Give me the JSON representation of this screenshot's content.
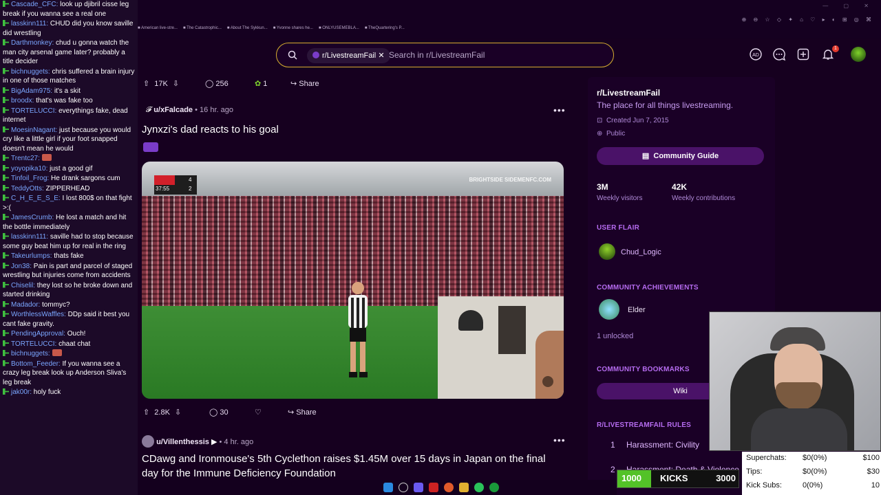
{
  "chat": [
    {
      "user": "Cascade_CFC",
      "text": "look up djibril cisse leg break if you wanna see a real one"
    },
    {
      "user": "lasskinn111",
      "text": "CHUD did you know saville did wrestling"
    },
    {
      "user": "Darthmonkey",
      "text": "chud u gonna watch the man city arsenal game later? probably a title decider"
    },
    {
      "user": "bichnuggets",
      "text": "chris suffered a brain injury in one of those matches"
    },
    {
      "user": "BigAdam975",
      "text": "it's a skit"
    },
    {
      "user": "broodx",
      "text": "that's was fake too"
    },
    {
      "user": "TORTELUCCI",
      "text": "everythings fake, dead internet"
    },
    {
      "user": "MoesinNagant",
      "text": "just because you would cry like a little girl if your foot snapped doesn't mean he would"
    },
    {
      "user": "Trentc27",
      "text": ""
    },
    {
      "user": "yoyopika10",
      "text": "just a good gif"
    },
    {
      "user": "Tinfoil_Frog",
      "text": "He drank sargons cum"
    },
    {
      "user": "TeddyOtts",
      "text": "ZIPPERHEAD"
    },
    {
      "user": "C_H_E_E_S_E",
      "text": "I lost 800$ on that fight >:("
    },
    {
      "user": "JamesCrumb",
      "text": "He lost a match and hit the bottle immediately"
    },
    {
      "user": "lasskinn111",
      "text": "saville had to stop because some guy beat him up for real in the ring"
    },
    {
      "user": "Takeurlumps",
      "text": "thats fake"
    },
    {
      "user": "Jon38",
      "text": "Pain is part and parcel of staged wrestling but injuries come from accidents"
    },
    {
      "user": "Chiselil",
      "text": "they lost so he broke down and started drinking"
    },
    {
      "user": "Madador",
      "text": "tommyc?"
    },
    {
      "user": "WorthlessWaffles",
      "text": "DDp said it best you cant fake gravity."
    },
    {
      "user": "PendingApproval",
      "text": "Ouch!"
    },
    {
      "user": "TORTELUCCI",
      "text": "chaat chat"
    },
    {
      "user": "bichnuggets",
      "text": ""
    },
    {
      "user": "Bottom_Feeder",
      "text": "If you wanna see a crazy leg break look up Anderson Sliva's leg break"
    },
    {
      "user": "jak00r",
      "text": "holy fuck"
    }
  ],
  "browser": {
    "bookmarks": [
      "American live-stre...",
      "The Catastrophic...",
      "About The Sykkun...",
      "Yvonne shares he...",
      "ONLYUSEMEBLA...",
      "TheQuartering's P..."
    ]
  },
  "header": {
    "subreddit_chip": "r/LivestreamFail",
    "search_placeholder": "Search in r/LivestreamFail",
    "notification_count": "1"
  },
  "posts": [
    {
      "upvotes": "17K",
      "comments": "256",
      "awards": "1",
      "share_label": "Share"
    },
    {
      "author": "u/xFalcade",
      "age": "16 hr. ago",
      "title": "Jynxzi's dad reacts to his goal",
      "video": {
        "watermark": "BRIGHTSIDE  SIDEMENFC.COM",
        "score_time": "37:55",
        "score_home": "4",
        "score_away": "2"
      },
      "upvotes": "2.8K",
      "comments": "30",
      "share_label": "Share"
    },
    {
      "author": "u/Villenthessis",
      "age": "4 hr. ago",
      "title": "CDawg and Ironmouse's 5th Cyclethon raises $1.45M over 15 days in Japan on the final day for the Immune Deficiency Foundation"
    }
  ],
  "sidebar": {
    "name": "r/LivestreamFail",
    "description": "The place for all things livestreaming.",
    "created": "Created Jun 7, 2015",
    "visibility": "Public",
    "guide_label": "Community Guide",
    "stats": [
      {
        "value": "3M",
        "label": "Weekly visitors"
      },
      {
        "value": "42K",
        "label": "Weekly contributions"
      }
    ],
    "user_flair_heading": "USER FLAIR",
    "user_flair_name": "Chud_Logic",
    "achievements_heading": "COMMUNITY ACHIEVEMENTS",
    "achievement_name": "Elder",
    "unlocked": "1 unlocked",
    "bookmarks_heading": "COMMUNITY BOOKMARKS",
    "wiki_label": "Wiki",
    "rules_heading": "R/LIVESTREAMFAIL RULES",
    "rules": [
      {
        "num": "1",
        "text": "Harassment: Civility"
      },
      {
        "num": "2",
        "text": "Harassment: Death & Violence"
      }
    ]
  },
  "donations": {
    "rows": [
      {
        "label": "Superchats:",
        "value": "$0(0%)",
        "goal": "$100"
      },
      {
        "label": "Tips:",
        "value": "$0(0%)",
        "goal": "$30"
      },
      {
        "label": "Kick Subs:",
        "value": "0(0%)",
        "goal": "10"
      }
    ]
  },
  "kicks": {
    "start": "1000",
    "label": "KICKS",
    "goal": "3000",
    "progress": 0.28
  },
  "colors": {
    "accent": "#4a1268",
    "search_border": "#d8b030",
    "chat_bg": "#1c0a28",
    "kicks_fill": "#53c228"
  }
}
